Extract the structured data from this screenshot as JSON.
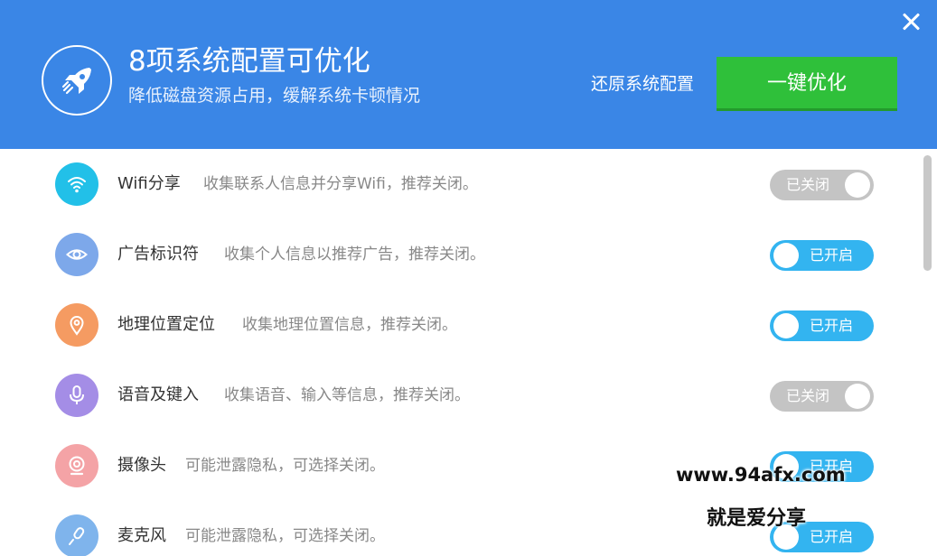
{
  "header": {
    "title": "8项系统配置可优化",
    "subtitle": "降低磁盘资源占用，缓解系统卡顿情况",
    "restore_label": "还原系统配置",
    "optimize_label": "一键优化",
    "icon": "rocket-icon",
    "close_icon": "close-icon"
  },
  "items": [
    {
      "name": "Wifi分享",
      "desc": "收集联系人信息并分享Wifi，推荐关闭。",
      "status": "已关闭",
      "enabled": false,
      "icon": "wifi-icon",
      "icon_color": "#22c0e8"
    },
    {
      "name": "广告标识符",
      "desc": "收集个人信息以推荐广告，推荐关闭。",
      "status": "已开启",
      "enabled": true,
      "icon": "eye-icon",
      "icon_color": "#7da8ea"
    },
    {
      "name": "地理位置定位",
      "desc": "收集地理位置信息，推荐关闭。",
      "status": "已开启",
      "enabled": true,
      "icon": "location-pin-icon",
      "icon_color": "#f59b62"
    },
    {
      "name": "语音及键入",
      "desc": "收集语音、输入等信息，推荐关闭。",
      "status": "已关闭",
      "enabled": false,
      "icon": "microphone-icon",
      "icon_color": "#a48de6"
    },
    {
      "name": "摄像头",
      "desc": "可能泄露隐私，可选择关闭。",
      "status": "已开启",
      "enabled": true,
      "icon": "camera-icon",
      "icon_color": "#f4a3a6"
    },
    {
      "name": "麦克风",
      "desc": "可能泄露隐私，可选择关闭。",
      "status": "已开启",
      "enabled": true,
      "icon": "microphone-icon",
      "icon_color": "#7fb4ec"
    }
  ],
  "watermark": {
    "line1": "www.94afx.com",
    "line2": "就是爱分享"
  },
  "colors": {
    "header_bg": "#3a86e6",
    "optimize_button": "#2fc03a",
    "toggle_on": "#33b4f0",
    "toggle_off": "#c4c4c4"
  }
}
